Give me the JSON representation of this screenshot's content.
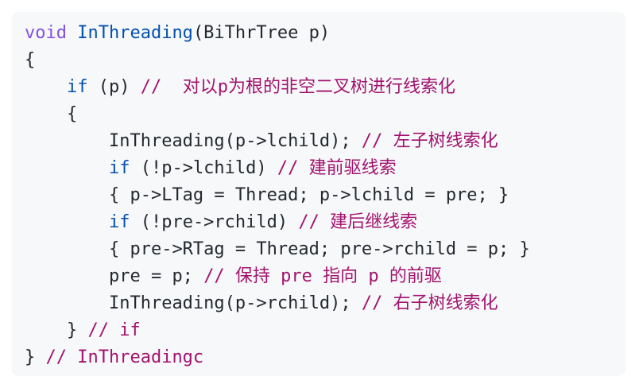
{
  "code": {
    "lines": [
      {
        "indent": "",
        "segments": [
          {
            "type": "kw-void",
            "text": "void"
          },
          {
            "type": "plain",
            "text": " "
          },
          {
            "type": "fn-name",
            "text": "InThreading"
          },
          {
            "type": "plain",
            "text": "(BiThrTree p)"
          }
        ]
      },
      {
        "indent": "",
        "segments": [
          {
            "type": "plain",
            "text": "{"
          }
        ]
      },
      {
        "indent": "    ",
        "segments": [
          {
            "type": "kw",
            "text": "if"
          },
          {
            "type": "plain",
            "text": " (p) "
          },
          {
            "type": "comment",
            "text": "//  对以p为根的非空二叉树进行线索化"
          }
        ]
      },
      {
        "indent": "    ",
        "segments": [
          {
            "type": "plain",
            "text": "{"
          }
        ]
      },
      {
        "indent": "        ",
        "segments": [
          {
            "type": "plain",
            "text": "InThreading(p->lchild); "
          },
          {
            "type": "comment",
            "text": "// 左子树线索化"
          }
        ]
      },
      {
        "indent": "        ",
        "segments": [
          {
            "type": "kw",
            "text": "if"
          },
          {
            "type": "plain",
            "text": " (!p->lchild) "
          },
          {
            "type": "comment",
            "text": "// 建前驱线索"
          }
        ]
      },
      {
        "indent": "        ",
        "segments": [
          {
            "type": "plain",
            "text": "{ p->LTag = Thread; p->lchild = pre; }"
          }
        ]
      },
      {
        "indent": "        ",
        "segments": [
          {
            "type": "kw",
            "text": "if"
          },
          {
            "type": "plain",
            "text": " (!pre->rchild) "
          },
          {
            "type": "comment",
            "text": "// 建后继线索"
          }
        ]
      },
      {
        "indent": "        ",
        "segments": [
          {
            "type": "plain",
            "text": "{ pre->RTag = Thread; pre->rchild = p; }"
          }
        ]
      },
      {
        "indent": "        ",
        "segments": [
          {
            "type": "plain",
            "text": "pre = p; "
          },
          {
            "type": "comment",
            "text": "// 保持 pre 指向 p 的前驱"
          }
        ]
      },
      {
        "indent": "        ",
        "segments": [
          {
            "type": "plain",
            "text": "InThreading(p->rchild); "
          },
          {
            "type": "comment",
            "text": "// 右子树线索化"
          }
        ]
      },
      {
        "indent": "    ",
        "segments": [
          {
            "type": "plain",
            "text": "} "
          },
          {
            "type": "comment",
            "text": "// if"
          }
        ]
      },
      {
        "indent": "",
        "segments": [
          {
            "type": "plain",
            "text": "} "
          },
          {
            "type": "comment",
            "text": "// InThreadingc"
          }
        ]
      }
    ]
  },
  "colors": {
    "background": "#f6f8fa",
    "keyword_void": "#8250df",
    "function_name": "#0550ae",
    "keyword": "#0550ae",
    "comment": "#a3136e",
    "text": "#24292f"
  }
}
